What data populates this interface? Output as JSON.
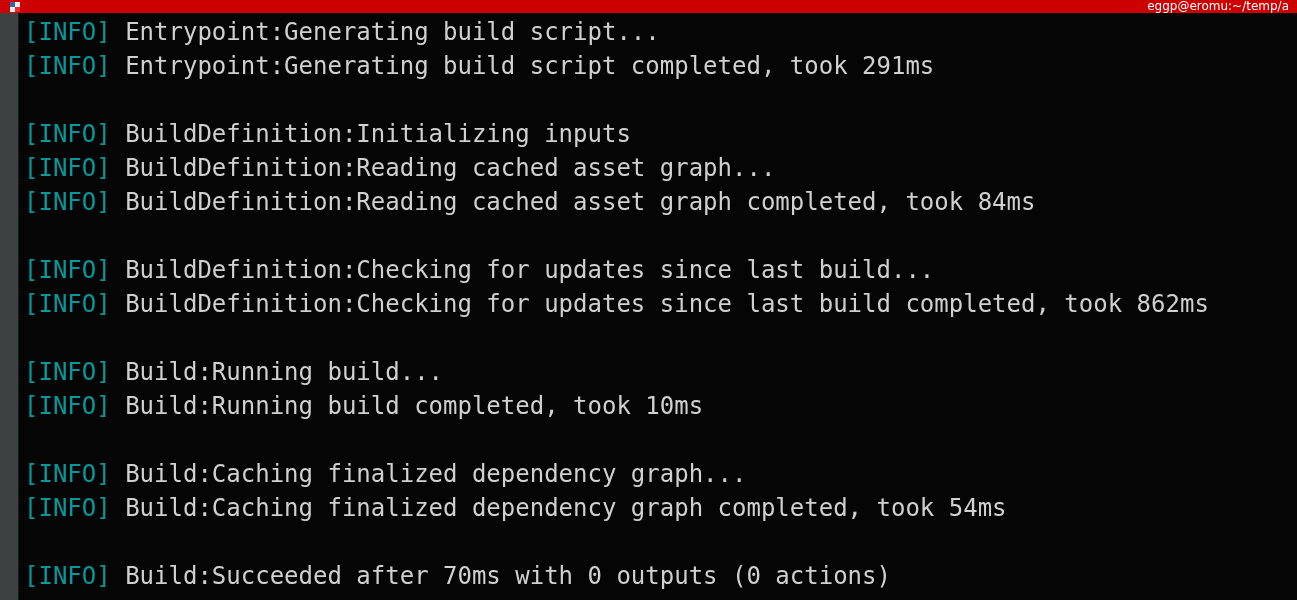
{
  "window": {
    "title": "eggp@eromu:~/temp/a"
  },
  "log_groups": [
    {
      "lines": [
        {
          "level": "[INFO]",
          "message": "Entrypoint:Generating build script..."
        },
        {
          "level": "[INFO]",
          "message": "Entrypoint:Generating build script completed, took 291ms"
        }
      ]
    },
    {
      "lines": [
        {
          "level": "[INFO]",
          "message": "BuildDefinition:Initializing inputs"
        },
        {
          "level": "[INFO]",
          "message": "BuildDefinition:Reading cached asset graph..."
        },
        {
          "level": "[INFO]",
          "message": "BuildDefinition:Reading cached asset graph completed, took 84ms"
        }
      ]
    },
    {
      "lines": [
        {
          "level": "[INFO]",
          "message": "BuildDefinition:Checking for updates since last build..."
        },
        {
          "level": "[INFO]",
          "message": "BuildDefinition:Checking for updates since last build completed, took 862ms"
        }
      ]
    },
    {
      "lines": [
        {
          "level": "[INFO]",
          "message": "Build:Running build..."
        },
        {
          "level": "[INFO]",
          "message": "Build:Running build completed, took 10ms"
        }
      ]
    },
    {
      "lines": [
        {
          "level": "[INFO]",
          "message": "Build:Caching finalized dependency graph..."
        },
        {
          "level": "[INFO]",
          "message": "Build:Caching finalized dependency graph completed, took 54ms"
        }
      ]
    },
    {
      "lines": [
        {
          "level": "[INFO]",
          "message": "Build:Succeeded after 70ms with 0 outputs (0 actions)"
        }
      ]
    }
  ]
}
